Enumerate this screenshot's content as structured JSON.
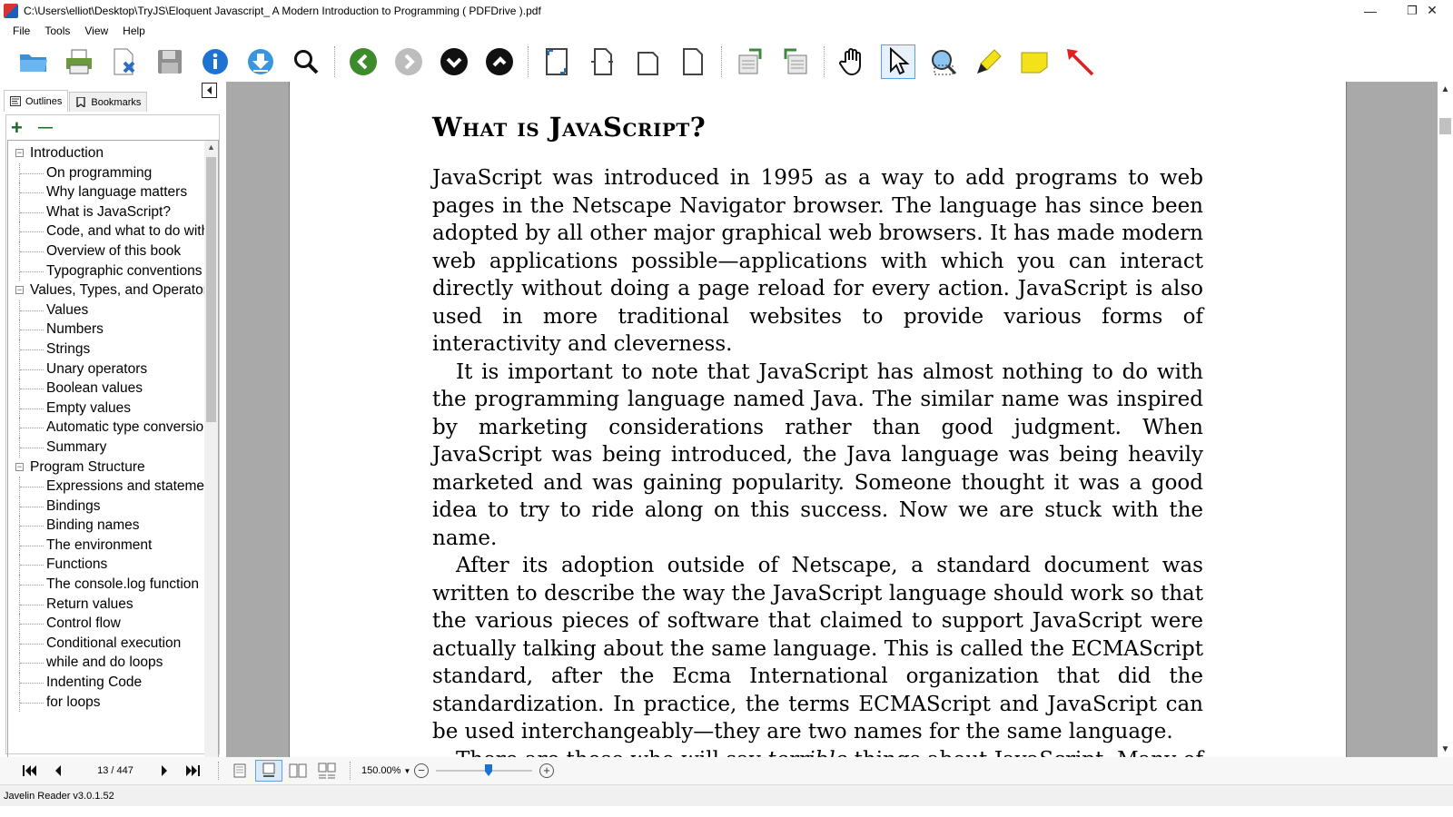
{
  "window": {
    "title": "C:\\Users\\elliot\\Desktop\\TryJS\\Eloquent Javascript_ A Modern Introduction to Programming ( PDFDrive ).pdf",
    "minimize": "—",
    "restore": "❐",
    "close": "✕"
  },
  "menu": {
    "items": [
      {
        "label": "File"
      },
      {
        "label": "Tools"
      },
      {
        "label": "View"
      },
      {
        "label": "Help"
      }
    ]
  },
  "sidebar": {
    "tabs": [
      {
        "label": "Outlines"
      },
      {
        "label": "Bookmarks"
      }
    ],
    "expand_all": "+",
    "collapse_all": "—",
    "tree": [
      {
        "label": "Introduction",
        "level": 0
      },
      {
        "label": "On programming",
        "level": 1
      },
      {
        "label": "Why language matters",
        "level": 1
      },
      {
        "label": "What is JavaScript?",
        "level": 1
      },
      {
        "label": "Code, and what to do with",
        "level": 1
      },
      {
        "label": "Overview of this book",
        "level": 1
      },
      {
        "label": "Typographic conventions",
        "level": 1
      },
      {
        "label": "Values, Types, and Operators",
        "level": 0
      },
      {
        "label": "Values",
        "level": 1
      },
      {
        "label": "Numbers",
        "level": 1
      },
      {
        "label": "Strings",
        "level": 1
      },
      {
        "label": "Unary operators",
        "level": 1
      },
      {
        "label": "Boolean values",
        "level": 1
      },
      {
        "label": "Empty values",
        "level": 1
      },
      {
        "label": "Automatic type conversion",
        "level": 1
      },
      {
        "label": "Summary",
        "level": 1
      },
      {
        "label": "Program Structure",
        "level": 0
      },
      {
        "label": "Expressions and statements",
        "level": 1
      },
      {
        "label": "Bindings",
        "level": 1
      },
      {
        "label": "Binding names",
        "level": 1
      },
      {
        "label": "The environment",
        "level": 1
      },
      {
        "label": "Functions",
        "level": 1
      },
      {
        "label": "The console.log function",
        "level": 1
      },
      {
        "label": "Return values",
        "level": 1
      },
      {
        "label": "Control flow",
        "level": 1
      },
      {
        "label": "Conditional execution",
        "level": 1
      },
      {
        "label": "while and do loops",
        "level": 1
      },
      {
        "label": "Indenting Code",
        "level": 1
      },
      {
        "label": "for loops",
        "level": 1
      }
    ]
  },
  "document": {
    "heading": "What is JavaScript?",
    "p1": "JavaScript was introduced in 1995 as a way to add programs to web pages in the Netscape Navigator browser. The language has since been adopted by all other major graphical web browsers. It has made modern web applications possible—applications with which you can interact directly without doing a page reload for every action. JavaScript is also used in more traditional websites to provide various forms of interactivity and cleverness.",
    "p2": "It is important to note that JavaScript has almost nothing to do with the programming language named Java. The similar name was inspired by marketing considerations rather than good judgment. When JavaScript was being introduced, the Java language was being heavily marketed and was gaining popularity. Someone thought it was a good idea to try to ride along on this success. Now we are stuck with the name.",
    "p3": "After its adoption outside of Netscape, a standard document was written to describe the way the JavaScript language should work so that the various pieces of software that claimed to support JavaScript were actually talking about the same language. This is called the ECMAScript standard, after the Ecma International organization that did the standardization. In practice, the terms ECMAScript and JavaScript can be used interchangeably—they are two names for the same language.",
    "p4_a": "There are those who will say ",
    "p4_em": "terrible",
    "p4_b": " things about JavaScript. Many of these things are true. When I was required to write something in JavaScript for the first time, I quickly came to despise it. It would accept almost anything I typed"
  },
  "navigation": {
    "page_indicator": "13 / 447",
    "zoom": "150.00%",
    "zoom_fraction": 0.55
  },
  "status": {
    "app_version": "Javelin Reader v3.0.1.52"
  },
  "colors": {
    "accent": "#1e73d0",
    "doc_background": "#a9a9a9",
    "tree_plus": "#1b6b27"
  }
}
